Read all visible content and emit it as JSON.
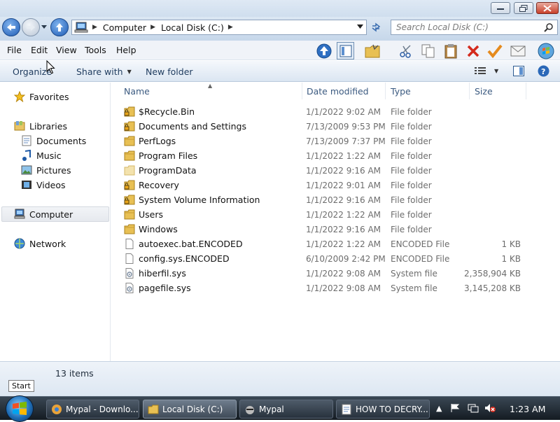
{
  "address": {
    "crumbs": [
      "Computer",
      "Local Disk (C:)"
    ]
  },
  "search": {
    "placeholder": "Search Local Disk (C:)"
  },
  "menu": [
    "File",
    "Edit",
    "View",
    "Tools",
    "Help"
  ],
  "commands": {
    "organize": "Organize",
    "share_with": "Share with",
    "new_folder": "New folder"
  },
  "nav": {
    "favorites": "Favorites",
    "libraries": "Libraries",
    "documents": "Documents",
    "music": "Music",
    "pictures": "Pictures",
    "videos": "Videos",
    "computer": "Computer",
    "network": "Network"
  },
  "columns": {
    "name": "Name",
    "date": "Date modified",
    "type": "Type",
    "size": "Size"
  },
  "files": [
    {
      "name": "$Recycle.Bin",
      "date": "1/1/2022 9:02 AM",
      "type": "File folder",
      "size": "",
      "icon": "locked-folder-icon"
    },
    {
      "name": "Documents and Settings",
      "date": "7/13/2009 9:53 PM",
      "type": "File folder",
      "size": "",
      "icon": "locked-folder-icon"
    },
    {
      "name": "PerfLogs",
      "date": "7/13/2009 7:37 PM",
      "type": "File folder",
      "size": "",
      "icon": "folder-icon"
    },
    {
      "name": "Program Files",
      "date": "1/1/2022 1:22 AM",
      "type": "File folder",
      "size": "",
      "icon": "folder-icon"
    },
    {
      "name": "ProgramData",
      "date": "1/1/2022 9:16 AM",
      "type": "File folder",
      "size": "",
      "icon": "hidden-folder-icon"
    },
    {
      "name": "Recovery",
      "date": "1/1/2022 9:01 AM",
      "type": "File folder",
      "size": "",
      "icon": "locked-folder-icon"
    },
    {
      "name": "System Volume Information",
      "date": "1/1/2022 9:16 AM",
      "type": "File folder",
      "size": "",
      "icon": "locked-folder-icon"
    },
    {
      "name": "Users",
      "date": "1/1/2022 1:22 AM",
      "type": "File folder",
      "size": "",
      "icon": "folder-icon"
    },
    {
      "name": "Windows",
      "date": "1/1/2022 9:16 AM",
      "type": "File folder",
      "size": "",
      "icon": "folder-icon"
    },
    {
      "name": "autoexec.bat.ENCODED",
      "date": "1/1/2022 1:22 AM",
      "type": "ENCODED File",
      "size": "1 KB",
      "icon": "file-icon"
    },
    {
      "name": "config.sys.ENCODED",
      "date": "6/10/2009 2:42 PM",
      "type": "ENCODED File",
      "size": "1 KB",
      "icon": "file-icon"
    },
    {
      "name": "hiberfil.sys",
      "date": "1/1/2022 9:08 AM",
      "type": "System file",
      "size": "2,358,904 KB",
      "icon": "system-file-icon"
    },
    {
      "name": "pagefile.sys",
      "date": "1/1/2022 9:08 AM",
      "type": "System file",
      "size": "3,145,208 KB",
      "icon": "system-file-icon"
    }
  ],
  "details": {
    "count": "13 items",
    "start_label": "Start"
  },
  "taskbar": {
    "tasks": [
      "Mypal - Downlo...",
      "Local Disk (C:)",
      "Mypal",
      "HOW TO DECRY..."
    ],
    "clock": "1:23 AM"
  }
}
